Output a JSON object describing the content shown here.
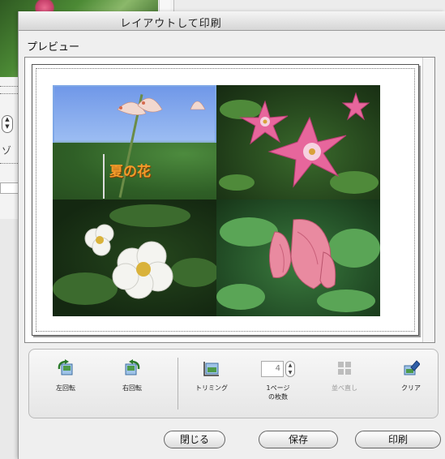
{
  "window": {
    "title": "レイアウトして印刷"
  },
  "preview": {
    "label": "プレビュー",
    "caption": "夏の花"
  },
  "toolbar": {
    "rotate_left": "左回転",
    "rotate_right": "右回転",
    "trim": "トリミング",
    "per_page_line1": "1ページ",
    "per_page_line2": "の枚数",
    "per_page_value": "4",
    "arrange": "並べ直し",
    "clear": "クリア"
  },
  "buttons": {
    "close": "閉じる",
    "save": "保存",
    "print": "印刷"
  },
  "colors": {
    "selection": "#7ea7e6",
    "caption": "#f29b2a"
  }
}
